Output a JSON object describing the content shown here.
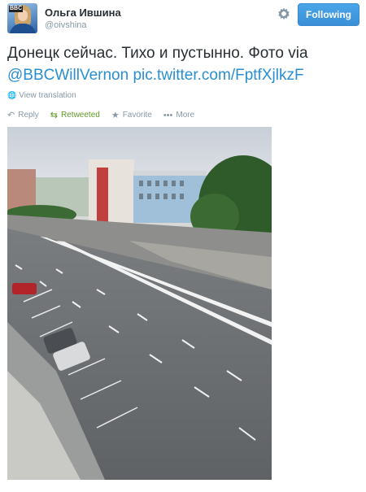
{
  "user": {
    "display_name": "Ольга Ившина",
    "username": "@oivshina"
  },
  "header": {
    "settings_icon": "gear-icon",
    "follow_label": "Following",
    "follow_color": "#3b94d9"
  },
  "tweet": {
    "text": "Донецк сейчас. Тихо и пустынно. Фото via ",
    "mention": "@BBCWillVernon",
    "link": "pic.twitter.com/FptfXjlkzF",
    "link_color": "#2a8fd0"
  },
  "translate": {
    "icon": "globe-icon",
    "label": "View translation"
  },
  "actions": {
    "reply": "Reply",
    "retweeted": "Retweeted",
    "favorite": "Favorite",
    "more": "More",
    "retweet_color": "#609928"
  },
  "photo": {
    "description_icon": "street-photo"
  }
}
